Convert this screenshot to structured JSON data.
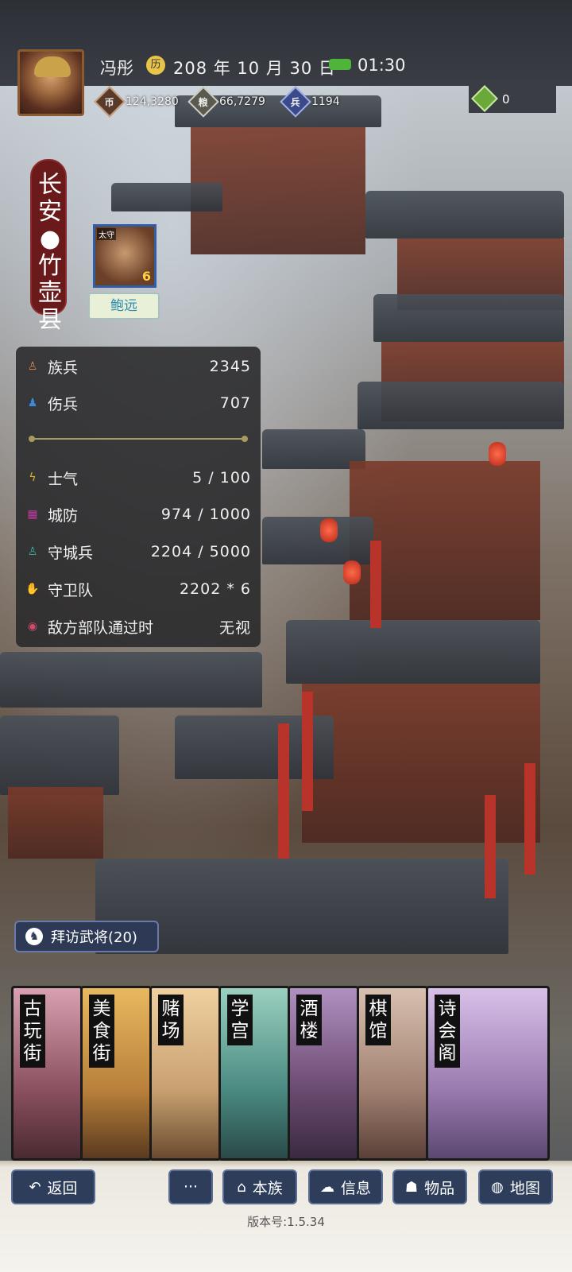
{
  "header": {
    "player_name": "冯彤",
    "date": "208 年 10 月 30 日",
    "time": "01:30",
    "resources": [
      {
        "icon": "coin-icon",
        "value": "124,3280"
      },
      {
        "icon": "grain-icon",
        "value": "66,7279"
      },
      {
        "icon": "soldier-icon",
        "value": "1194"
      }
    ],
    "gem_value": "0"
  },
  "city": {
    "name": "长安●竹壶县",
    "governor_tag": "太守",
    "governor_level": "6",
    "governor_name": "鲍远"
  },
  "stats": [
    {
      "label": "族兵",
      "value": "2345",
      "icon": "person-icon",
      "color": "#d98a4a"
    },
    {
      "label": "伤兵",
      "value": "707",
      "icon": "injured-icon",
      "color": "#3a8ad8"
    },
    {
      "label": "士气",
      "value": "5 / 100",
      "icon": "morale-icon",
      "color": "#e0b030"
    },
    {
      "label": "城防",
      "value": "974 / 1000",
      "icon": "wall-icon",
      "color": "#c03aa0"
    },
    {
      "label": "守城兵",
      "value": "2204 / 5000",
      "icon": "guard-icon",
      "color": "#3ab0a0"
    },
    {
      "label": "守卫队",
      "value": "2202 * 6",
      "icon": "squad-icon",
      "color": "#4ab040"
    },
    {
      "label": "敌方部队通过时",
      "value": "无视",
      "icon": "eye-icon",
      "color": "#d04a6a"
    }
  ],
  "visit_button": "拜访武将(20)",
  "buildings": [
    {
      "name": "古玩街",
      "bg": "#8a5060"
    },
    {
      "name": "美食街",
      "bg": "#b8803a"
    },
    {
      "name": "赌场",
      "bg": "#c8a070"
    },
    {
      "name": "学宫",
      "bg": "#4a8a80"
    },
    {
      "name": "酒楼",
      "bg": "#6a4a70"
    },
    {
      "name": "棋馆",
      "bg": "#a08070"
    },
    {
      "name": "诗会阁",
      "bg": "#9a7ab0"
    }
  ],
  "nav": {
    "back": "返回",
    "more": "···",
    "clan": "本族",
    "info": "信息",
    "items": "物品",
    "map": "地图"
  },
  "version": "版本号:1.5.34"
}
